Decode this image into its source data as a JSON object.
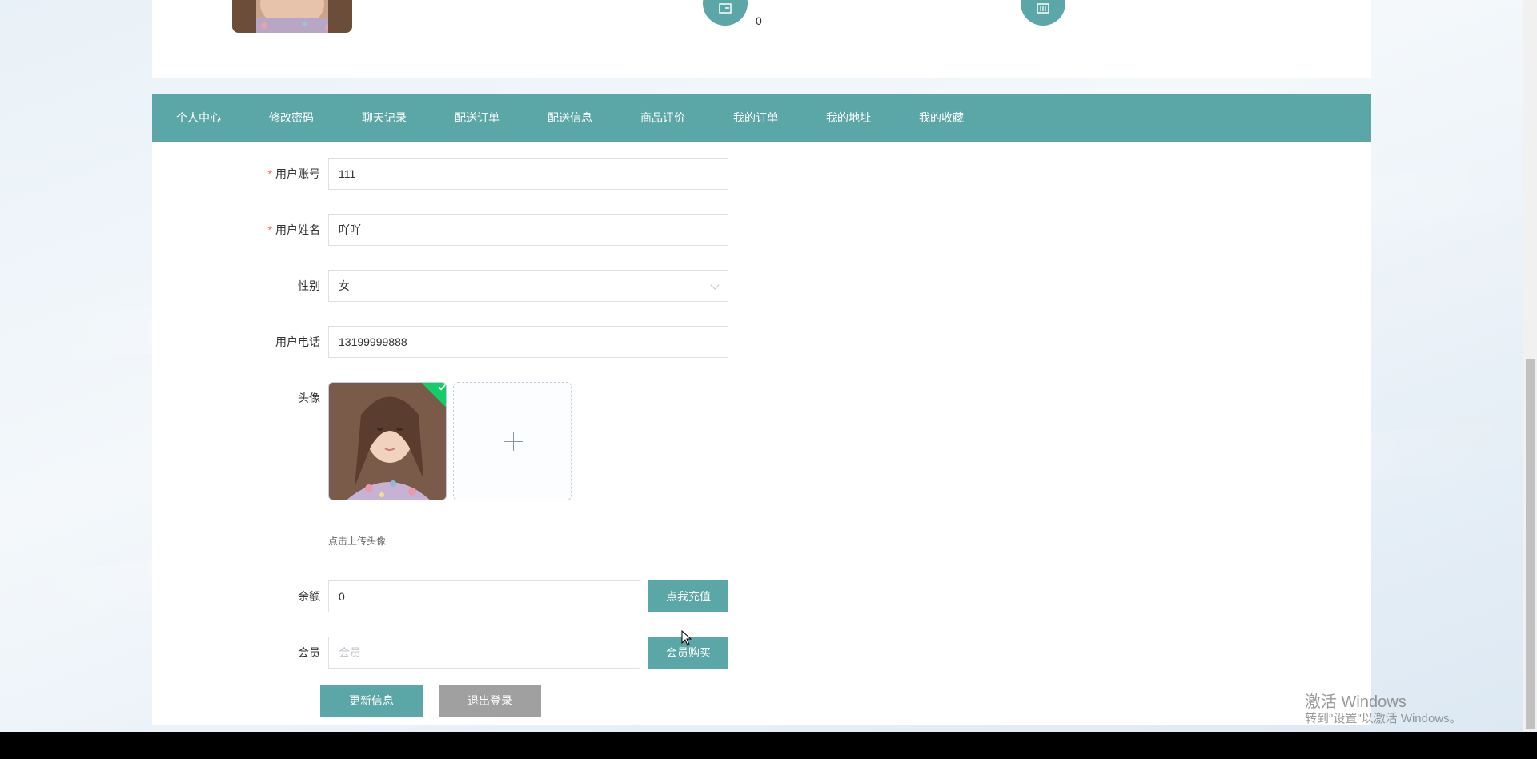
{
  "top_stats": {
    "balance_value": "0"
  },
  "nav": {
    "items": [
      "个人中心",
      "修改密码",
      "聊天记录",
      "配送订单",
      "配送信息",
      "商品评价",
      "我的订单",
      "我的地址",
      "我的收藏"
    ]
  },
  "form": {
    "account": {
      "label": "用户账号",
      "value": "111",
      "required": true
    },
    "name": {
      "label": "用户姓名",
      "value": "吖吖",
      "required": true
    },
    "gender": {
      "label": "性别",
      "value": "女"
    },
    "phone": {
      "label": "用户电话",
      "value": "13199999888"
    },
    "avatar": {
      "label": "头像",
      "hint": "点击上传头像"
    },
    "balance": {
      "label": "余额",
      "value": "0",
      "button": "点我充值"
    },
    "member": {
      "label": "会员",
      "placeholder": "会员",
      "button": "会员购买"
    }
  },
  "actions": {
    "update": "更新信息",
    "logout": "退出登录"
  },
  "watermark": {
    "line1": "激活 Windows",
    "line2": "转到\"设置\"以激活 Windows。"
  },
  "colors": {
    "accent": "#5ba6a6",
    "required": "#f56c6c",
    "gray_button": "#a0a0a0"
  }
}
